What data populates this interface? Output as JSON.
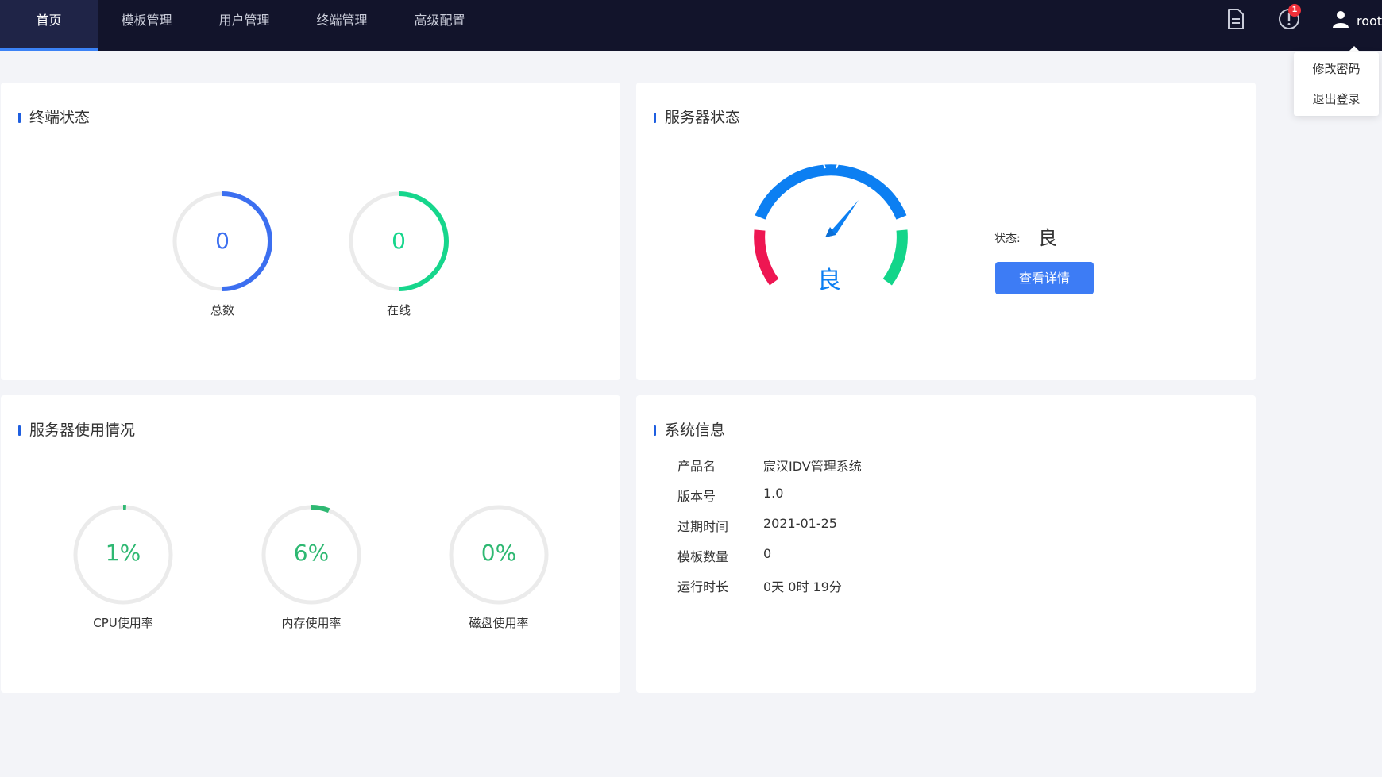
{
  "nav": {
    "items": [
      {
        "label": "首页",
        "active": true
      },
      {
        "label": "模板管理",
        "active": false
      },
      {
        "label": "用户管理",
        "active": false
      },
      {
        "label": "终端管理",
        "active": false
      },
      {
        "label": "高级配置",
        "active": false
      }
    ],
    "icons": [
      "document-icon",
      "alert-icon",
      "user-icon"
    ],
    "alert_badge": "1",
    "username": "root"
  },
  "user_menu": {
    "change_password": "修改密码",
    "logout": "退出登录"
  },
  "terminal_status": {
    "title": "终端状态",
    "total": {
      "value": "0",
      "label": "总数",
      "color": "#3c6ff0"
    },
    "online": {
      "value": "0",
      "label": "在线",
      "color": "#16d68c"
    }
  },
  "server_status": {
    "title": "服务器状态",
    "gauge_text": "良",
    "gauge_colors": {
      "good": "#0c7ff2",
      "warn": "#ee1652",
      "ok": "#13d58a"
    },
    "status_label": "状态:",
    "status_value": "良",
    "detail_button": "查看详情"
  },
  "server_usage": {
    "title": "服务器使用情况",
    "items": [
      {
        "value": "1%",
        "percent": 1,
        "label": "CPU使用率"
      },
      {
        "value": "6%",
        "percent": 6,
        "label": "内存使用率"
      },
      {
        "value": "0%",
        "percent": 0,
        "label": "磁盘使用率"
      }
    ],
    "color": "#2eb872"
  },
  "system_info": {
    "title": "系统信息",
    "rows": [
      {
        "key": "产品名",
        "value": "宸汉IDV管理系统"
      },
      {
        "key": "版本号",
        "value": "1.0"
      },
      {
        "key": "过期时间",
        "value": "2021-01-25"
      },
      {
        "key": "模板数量",
        "value": "0"
      },
      {
        "key": "运行时长",
        "value": "0天 0时 19分"
      }
    ]
  }
}
